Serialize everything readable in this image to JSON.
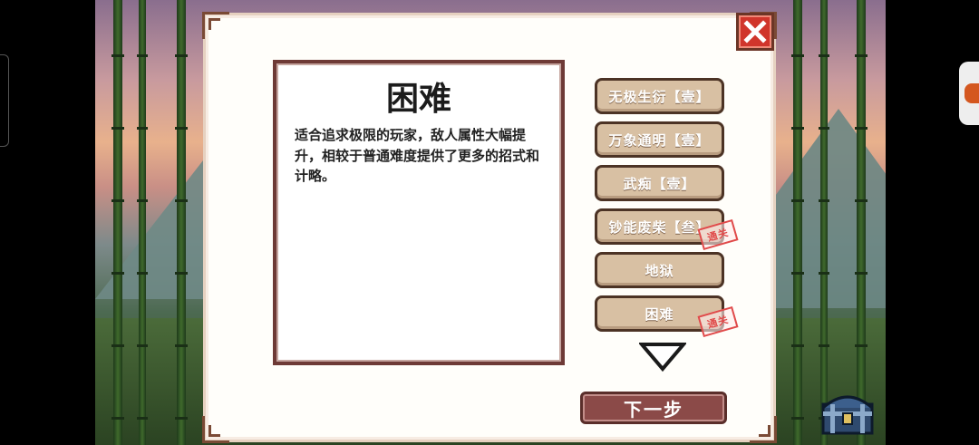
{
  "dialog": {
    "title": "困难",
    "description": "适合追求极限的玩家，敌人属性大幅提升，相较于普通难度提供了更多的招式和计略。"
  },
  "options": [
    {
      "label": "无极生衍【壹】",
      "cleared": false
    },
    {
      "label": "万象通明【壹】",
      "cleared": false
    },
    {
      "label": "武痴【壹】",
      "cleared": false
    },
    {
      "label": "钞能废柴【叁】",
      "cleared": true
    },
    {
      "label": "地狱",
      "cleared": false
    },
    {
      "label": "困难",
      "cleared": true
    }
  ],
  "stamp_text": "通关",
  "next_label": "下一步",
  "icons": {
    "close": "close-icon",
    "scroll_down": "chevron-down-icon",
    "chest": "treasure-chest-icon"
  },
  "colors": {
    "close": "#d0352b",
    "option": "#d8c0a3",
    "next": "#8b4a48",
    "stamp": "#e04a4a"
  }
}
